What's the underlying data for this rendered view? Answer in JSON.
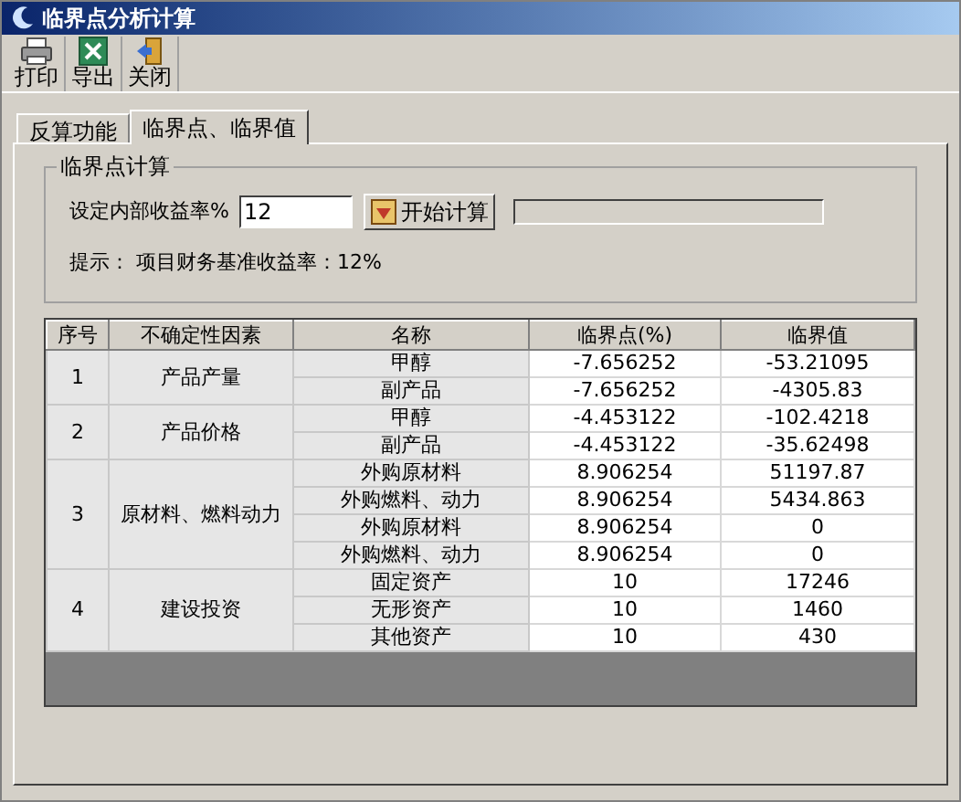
{
  "window": {
    "title": "临界点分析计算"
  },
  "toolbar": [
    {
      "kind": "print",
      "label": "打印"
    },
    {
      "kind": "export",
      "label": "导出"
    },
    {
      "kind": "close",
      "label": "关闭"
    }
  ],
  "tabs": [
    {
      "label": "反算功能",
      "selected": false
    },
    {
      "label": "临界点、临界值",
      "selected": true
    }
  ],
  "group": {
    "title": "临界点计算",
    "rate_label": "设定内部收益率%",
    "rate_value": "12",
    "button": "开始计算",
    "hint": "提示： 项目财务基准收益率：12%"
  },
  "progress": {
    "level": 0
  },
  "table": {
    "columns": [
      "序号",
      "不确定性因素",
      "名称",
      "临界点(%)",
      "临界值"
    ],
    "groups": [
      {
        "index": "1",
        "factor": "产品产量",
        "items": [
          {
            "name": "甲醇",
            "point": "-7.656252",
            "value": "-53.21095"
          },
          {
            "name": "副产品",
            "point": "-7.656252",
            "value": "-4305.83"
          }
        ]
      },
      {
        "index": "2",
        "factor": "产品价格",
        "items": [
          {
            "name": "甲醇",
            "point": "-4.453122",
            "value": "-102.4218"
          },
          {
            "name": "副产品",
            "point": "-4.453122",
            "value": "-35.62498"
          }
        ]
      },
      {
        "index": "3",
        "factor": "原材料、燃料动力",
        "items": [
          {
            "name": "外购原材料",
            "point": "8.906254",
            "value": "51197.87"
          },
          {
            "name": "外购燃料、动力",
            "point": "8.906254",
            "value": "5434.863"
          },
          {
            "name": "外购原材料",
            "point": "8.906254",
            "value": "0"
          },
          {
            "name": "外购燃料、动力",
            "point": "8.906254",
            "value": "0"
          }
        ]
      },
      {
        "index": "4",
        "factor": "建设投资",
        "items": [
          {
            "name": "固定资产",
            "point": "10",
            "value": "17246"
          },
          {
            "name": "无形资产",
            "point": "10",
            "value": "1460"
          },
          {
            "name": "其他资产",
            "point": "10",
            "value": "430"
          }
        ]
      }
    ]
  }
}
